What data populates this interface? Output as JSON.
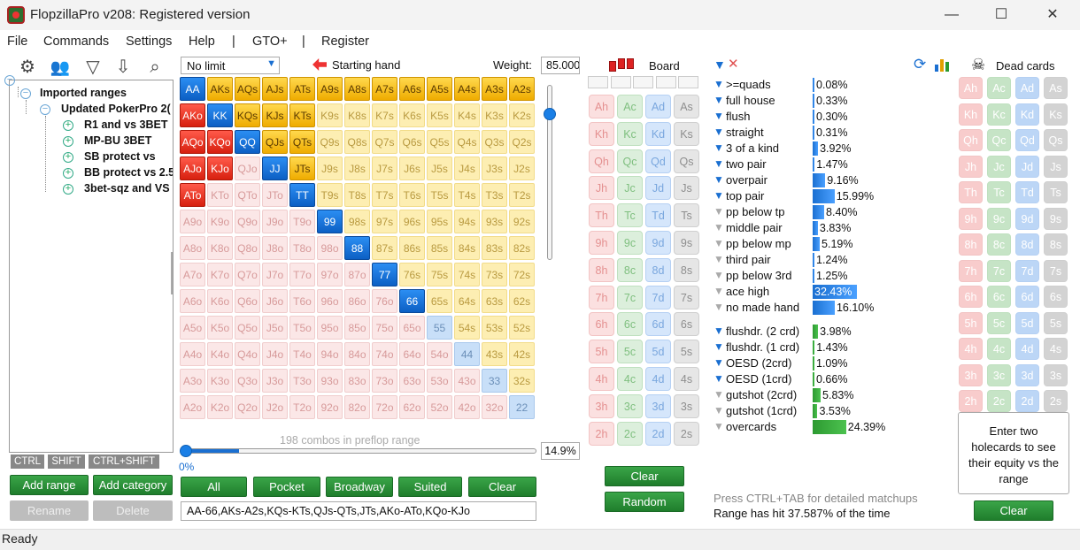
{
  "window": {
    "title": "FlopzillaPro v208: Registered version",
    "min": "—",
    "max": "☐",
    "close": "✕"
  },
  "menu": [
    "File",
    "Commands",
    "Settings",
    "Help",
    "|",
    "GTO+",
    "|",
    "Register"
  ],
  "tree": {
    "root": "Imported ranges",
    "folder": "Updated PokerPro 2(",
    "items": [
      "R1 and vs 3BET",
      "MP-BU 3BET",
      "SB protect vs",
      "BB protect vs 2.5",
      "3bet-sqz and VS"
    ]
  },
  "modkeys": [
    "CTRL",
    "SHIFT",
    "CTRL+SHIFT"
  ],
  "left_buttons": {
    "add_range": "Add range",
    "add_category": "Add category",
    "rename": "Rename",
    "delete": "Delete"
  },
  "range": {
    "game": "No limit",
    "starting_hand_label": "Starting hand",
    "weight_label": "Weight:",
    "weight_value": "85.000",
    "combos_text": "198 combos in preflop range",
    "slider_min": "0%",
    "percent": "14.9%",
    "range_text": "AA-66,AKs-A2s,KQs-KTs,QJs-QTs,JTs,AKo-ATo,KQo-KJo",
    "selected_fraction": 0.149,
    "buttons": [
      "All",
      "Pocket",
      "Broadway",
      "Suited",
      "Clear"
    ],
    "selected": [
      "AA",
      "KK",
      "QQ",
      "JJ",
      "TT",
      "99",
      "88",
      "77",
      "66",
      "AKs",
      "AQs",
      "AJs",
      "ATs",
      "A9s",
      "A8s",
      "A7s",
      "A6s",
      "A5s",
      "A4s",
      "A3s",
      "A2s",
      "KQs",
      "KJs",
      "KTs",
      "QJs",
      "QTs",
      "JTs",
      "AKo",
      "AQo",
      "AJo",
      "ATo",
      "KQo",
      "KJo"
    ],
    "light": [
      "55",
      "44",
      "33",
      "22"
    ]
  },
  "board": {
    "label": "Board",
    "ranks": [
      "A",
      "K",
      "Q",
      "J",
      "T",
      "9",
      "8",
      "7",
      "6",
      "5",
      "4",
      "3",
      "2"
    ],
    "suits": [
      "h",
      "c",
      "d",
      "s"
    ],
    "clear": "Clear",
    "random": "Random"
  },
  "stats": {
    "rows": [
      {
        "label": ">=quads",
        "value": "0.08%",
        "pct": 0.08,
        "active": true,
        "color": "blue"
      },
      {
        "label": "full house",
        "value": "0.33%",
        "pct": 0.33,
        "active": true,
        "color": "blue"
      },
      {
        "label": "flush",
        "value": "0.30%",
        "pct": 0.3,
        "active": true,
        "color": "blue"
      },
      {
        "label": "straight",
        "value": "0.31%",
        "pct": 0.31,
        "active": true,
        "color": "blue"
      },
      {
        "label": "3 of a kind",
        "value": "3.92%",
        "pct": 3.92,
        "active": true,
        "color": "blue"
      },
      {
        "label": "two pair",
        "value": "1.47%",
        "pct": 1.47,
        "active": true,
        "color": "blue"
      },
      {
        "label": "overpair",
        "value": "9.16%",
        "pct": 9.16,
        "active": true,
        "color": "blue"
      },
      {
        "label": "top pair",
        "value": "15.99%",
        "pct": 15.99,
        "active": true,
        "color": "blue"
      },
      {
        "label": "pp below tp",
        "value": "8.40%",
        "pct": 8.4,
        "active": false,
        "color": "blue"
      },
      {
        "label": "middle pair",
        "value": "3.83%",
        "pct": 3.83,
        "active": false,
        "color": "blue"
      },
      {
        "label": "pp below mp",
        "value": "5.19%",
        "pct": 5.19,
        "active": false,
        "color": "blue"
      },
      {
        "label": "third pair",
        "value": "1.24%",
        "pct": 1.24,
        "active": false,
        "color": "blue"
      },
      {
        "label": "pp below 3rd",
        "value": "1.25%",
        "pct": 1.25,
        "active": false,
        "color": "blue"
      },
      {
        "label": "ace high",
        "value": "32.43%",
        "pct": 32.43,
        "active": false,
        "color": "blue"
      },
      {
        "label": "no made hand",
        "value": "16.10%",
        "pct": 16.1,
        "active": false,
        "color": "blue"
      },
      {
        "label": "flushdr. (2 crd)",
        "value": "3.98%",
        "pct": 3.98,
        "active": true,
        "color": "green"
      },
      {
        "label": "flushdr. (1 crd)",
        "value": "1.43%",
        "pct": 1.43,
        "active": true,
        "color": "green"
      },
      {
        "label": "OESD (2crd)",
        "value": "1.09%",
        "pct": 1.09,
        "active": true,
        "color": "green"
      },
      {
        "label": "OESD (1crd)",
        "value": "0.66%",
        "pct": 0.66,
        "active": true,
        "color": "green"
      },
      {
        "label": "gutshot (2crd)",
        "value": "5.83%",
        "pct": 5.83,
        "active": false,
        "color": "green"
      },
      {
        "label": "gutshot (1crd)",
        "value": "3.53%",
        "pct": 3.53,
        "active": false,
        "color": "green"
      },
      {
        "label": "overcards",
        "value": "24.39%",
        "pct": 24.39,
        "active": false,
        "color": "green"
      }
    ],
    "hint": "Press CTRL+TAB for detailed matchups",
    "hit_text": "Range has hit 37.587% of the time"
  },
  "dead": {
    "label": "Dead cards",
    "info": "Enter two holecards to see their equity vs the range",
    "clear": "Clear"
  },
  "status": "Ready"
}
